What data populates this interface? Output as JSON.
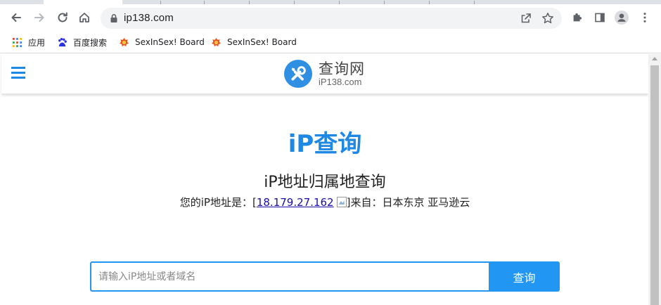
{
  "browser": {
    "url": "ip138.com",
    "bookmarks": [
      {
        "label": "应用",
        "icon": "apps-grid-icon"
      },
      {
        "label": "百度搜索",
        "icon": "baidu-paw-icon"
      },
      {
        "label": "SexInSex! Board",
        "icon": "site-favicon-icon"
      },
      {
        "label": "SexInSex! Board",
        "icon": "site-favicon-icon"
      }
    ]
  },
  "site": {
    "logo_cn": "查询网",
    "logo_en": "iP138.com",
    "title": "iP查询",
    "subtitle": "iP地址归属地查询",
    "ip_prefix": "您的iP地址是：[",
    "ip_address": "18.179.27.162",
    "ip_suffix": "]来自：日本东京 亚马逊云",
    "search_placeholder": "请输入iP地址或者域名",
    "search_button": "查询"
  },
  "colors": {
    "accent": "#1e88e5",
    "button": "#2196f3",
    "link": "#1a0dab"
  }
}
